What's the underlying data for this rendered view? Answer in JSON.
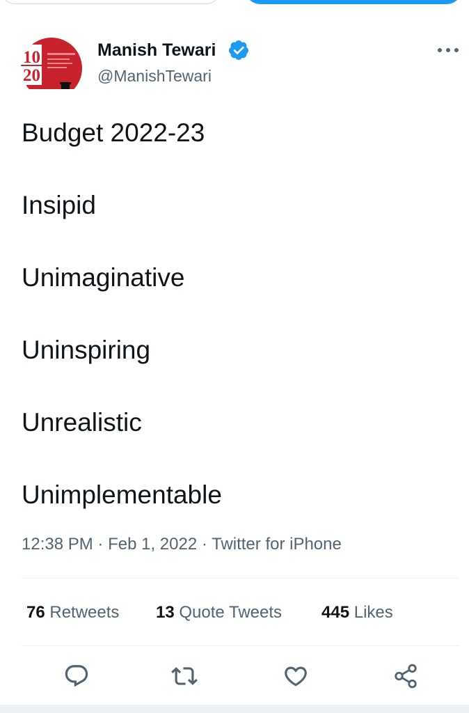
{
  "header": {
    "left_button_label": "",
    "right_button_label": ""
  },
  "tweet": {
    "author": {
      "name": "Manish Tewari",
      "handle": "@ManishTewari",
      "verified": true,
      "avatar_text_top": "10",
      "avatar_text_bottom": "20"
    },
    "lines": [
      "Budget 2022-23",
      "Insipid",
      "Unimaginative",
      "Uninspiring",
      "Unrealistic",
      "Unimplementable"
    ],
    "time": "12:38 PM",
    "date": "Feb 1, 2022",
    "source": "Twitter for iPhone",
    "separator": "·"
  },
  "stats": {
    "retweets": {
      "count": "76",
      "label": "Retweets"
    },
    "quotes": {
      "count": "13",
      "label": "Quote Tweets"
    },
    "likes": {
      "count": "445",
      "label": "Likes"
    }
  },
  "icons": {
    "reply": "reply-icon",
    "retweet": "retweet-icon",
    "like": "like-icon",
    "share": "share-icon",
    "more": "more-icon",
    "verified": "verified-badge-icon"
  },
  "colors": {
    "accent": "#1d9bf0",
    "text": "#0f1419",
    "secondary": "#536471",
    "divider": "#eff3f4",
    "avatar_red": "#c8232c"
  }
}
